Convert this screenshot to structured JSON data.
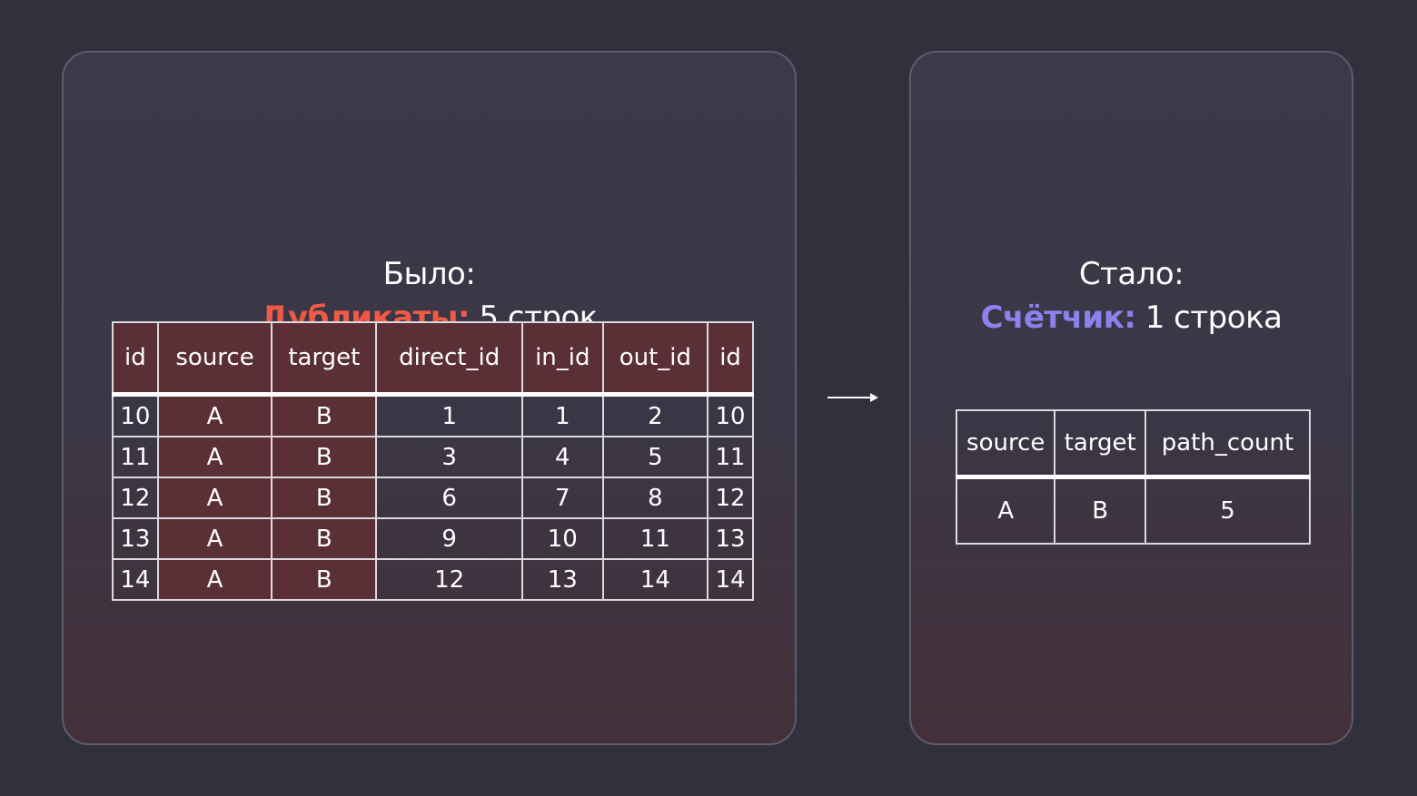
{
  "before": {
    "title": "Было:",
    "highlight": "Дубликаты:",
    "subtitle": " 5 строк",
    "highlight_color": "#f05a45",
    "columns": [
      "id",
      "source",
      "target",
      "direct_id",
      "in_id",
      "out_id",
      "id"
    ],
    "rows": [
      [
        "10",
        "A",
        "B",
        "1",
        "1",
        "2",
        "10"
      ],
      [
        "11",
        "A",
        "B",
        "3",
        "4",
        "5",
        "11"
      ],
      [
        "12",
        "A",
        "B",
        "6",
        "7",
        "8",
        "12"
      ],
      [
        "13",
        "A",
        "B",
        "9",
        "10",
        "11",
        "13"
      ],
      [
        "14",
        "A",
        "B",
        "12",
        "13",
        "14",
        "14"
      ]
    ],
    "duplicate_color": "#5a2f35"
  },
  "arrow": {
    "icon": "arrow-right-icon"
  },
  "after": {
    "title": "Стало:",
    "highlight": "Счётчик:",
    "subtitle": " 1 строка",
    "highlight_color": "#8c82ee",
    "columns": [
      "source",
      "target",
      "path_count"
    ],
    "rows": [
      [
        "A",
        "B",
        "5"
      ]
    ]
  }
}
